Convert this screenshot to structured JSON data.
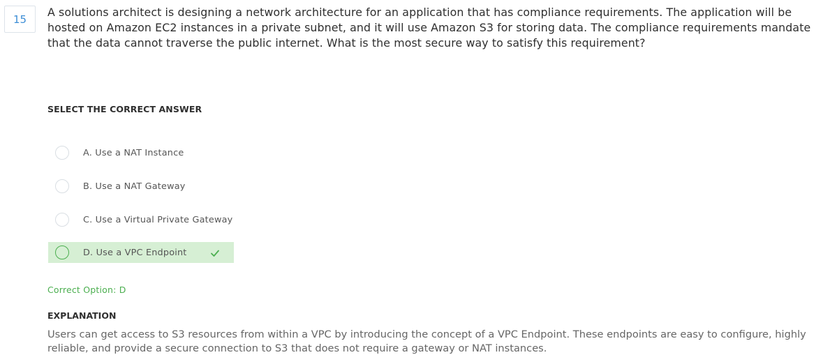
{
  "question": {
    "number": "15",
    "text": "A solutions architect is designing a network architecture for an application that has compliance requirements. The application will be hosted on Amazon EC2 instances in a private subnet, and it will use Amazon S3 for storing data. The compliance requirements mandate that the data cannot traverse the public internet. What is the most secure way to satisfy this requirement?"
  },
  "select_heading": "SELECT THE CORRECT ANSWER",
  "options": [
    {
      "label": "A. Use a NAT Instance",
      "correct": false
    },
    {
      "label": "B. Use a NAT Gateway",
      "correct": false
    },
    {
      "label": "C. Use a Virtual Private Gateway",
      "correct": false
    },
    {
      "label": "D. Use a VPC Endpoint",
      "correct": true
    }
  ],
  "correct_option": "Correct Option: D",
  "explanation": {
    "heading": "EXPLANATION",
    "text": "Users can get access to S3 resources from within a VPC by introducing the concept of a VPC Endpoint. These endpoints are easy to configure, highly reliable, and provide a secure connection to S3 that does not require a gateway or NAT instances."
  },
  "colors": {
    "accent_blue": "#3d8ed6",
    "correct_green": "#4caf50",
    "correct_bg": "#d6efd4"
  },
  "icons": {
    "correct_marker": "check-icon"
  }
}
